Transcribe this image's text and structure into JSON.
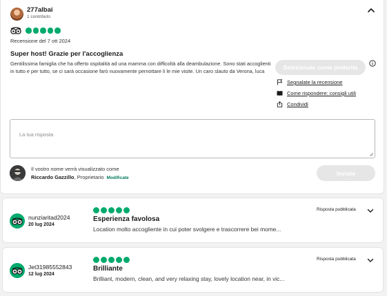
{
  "main_review": {
    "reviewer_name": "277albai",
    "contributions": "1 contributo",
    "rating": 5,
    "review_date": "Recensione del 7 ott 2024",
    "title": "Super host! Grazie per l'accoglienza",
    "body": "Gentilissima famiglia che ha offerto ospitalità ad una mamma con difficoltà alla deambulazione. Sono stati accoglienti in tutto e per tutto, se ci sarà occasione farò nuovamente pernottare li le mie visite. Un caro slauto da Verona, luca",
    "favorite_button": "Selezionate come preferita",
    "actions": {
      "report": "Segnalate la recensione",
      "how_to_reply": "Come rispondere: consigli utili",
      "share": "Condividi"
    },
    "reply_placeholder": "La tua risposta",
    "owner_note": "Il vostro nome verrà visualizzato come",
    "owner_name": "Riccardo Gazzillo",
    "owner_role": ", Proprietario",
    "modify_label": "Modificate",
    "send_button": "Inviate"
  },
  "other_reviews": [
    {
      "user": "nunziaritad2024",
      "date": "20 lug 2024",
      "rating": 5,
      "title": "Esperienza favolosa",
      "excerpt": "Location molto accogliente in cui poter svolgere e trascorrere bei mome...",
      "status": "Risposta pubblicata"
    },
    {
      "user": "Jet31985552843",
      "date": "12 lug 2024",
      "rating": 5,
      "title": "Brilliante",
      "excerpt": "Brilliant, modern, clean, and very relaxing stay, lovely location near, in vic...",
      "status": "Risposta pubblicata"
    }
  ],
  "colors": {
    "bubble_green": "#00aa6c",
    "disabled_button": "#e6e6e6",
    "link_green": "#00795a"
  },
  "icons": [
    "tripadvisor-owl-icon",
    "chevron-up-icon",
    "chevron-down-icon",
    "info-icon",
    "flag-icon",
    "book-icon",
    "share-icon",
    "resize-grip-icon"
  ]
}
